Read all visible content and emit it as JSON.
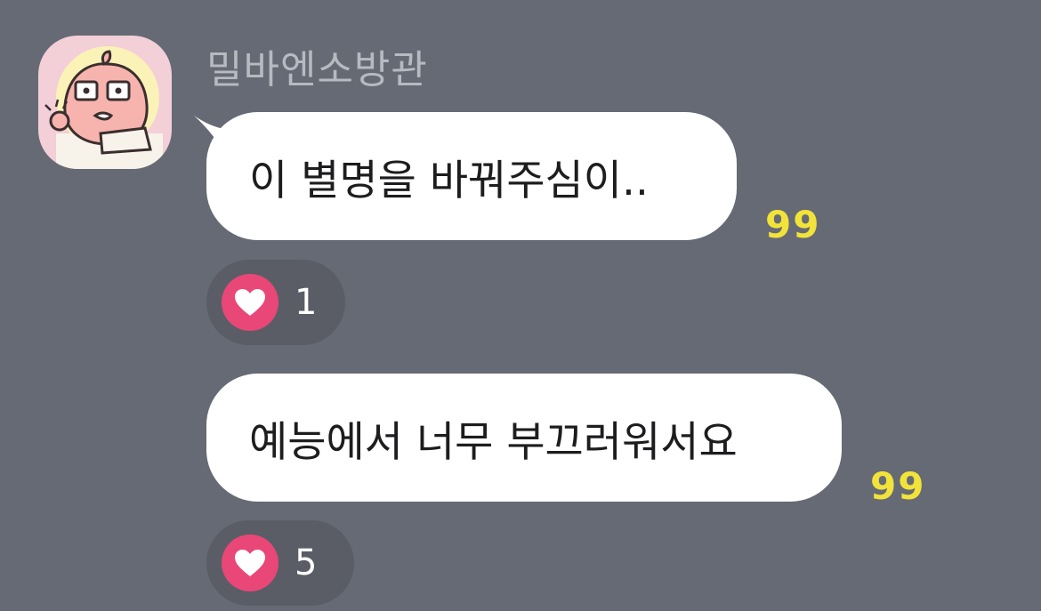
{
  "sender": {
    "name": "밀바엔소방관",
    "avatar": "peach-character-avatar"
  },
  "messages": [
    {
      "text": "이 별명을 바꿔주심이..",
      "unread_count": "99",
      "reaction": {
        "icon": "heart-icon",
        "count": "1"
      }
    },
    {
      "text": "예능에서 너무 부끄러워서요",
      "unread_count": "99",
      "reaction": {
        "icon": "heart-icon",
        "count": "5"
      }
    }
  ],
  "colors": {
    "background": "#666a74",
    "bubble": "#ffffff",
    "unread": "#f2e33a",
    "heart": "#e84777",
    "reaction_pill": "#5a5d66",
    "sender_name": "#b7bac1"
  }
}
